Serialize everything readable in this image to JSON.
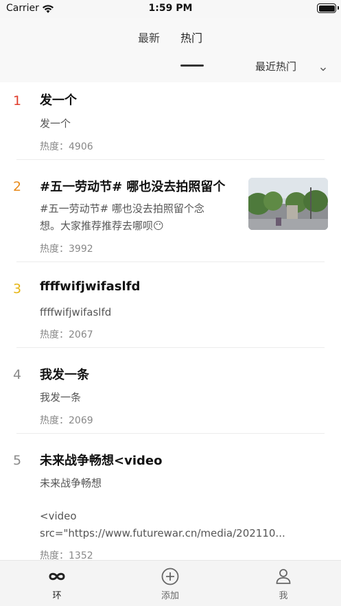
{
  "status_bar": {
    "carrier": "Carrier",
    "time": "1:59 PM"
  },
  "header": {
    "tabs": [
      {
        "label": "最新"
      },
      {
        "label": "热门"
      }
    ],
    "sort_label": "最近热门"
  },
  "feed": {
    "items": [
      {
        "rank": "1",
        "rank_color": "#e03c2b",
        "title": "发一个",
        "excerpt": "发一个",
        "heat": "热度：4906"
      },
      {
        "rank": "2",
        "rank_color": "#e88a1a",
        "title": "#五一劳动节# 哪也没去拍照留个",
        "excerpt_line1": "#五一劳动节# 哪也没去拍照留个念",
        "excerpt_line2": "想。大家推荐推荐去哪呗😶",
        "heat": "热度：3992"
      },
      {
        "rank": "3",
        "rank_color": "#e6b514",
        "title": "ffffwifjwifaslfd",
        "excerpt": "ffffwifjwifaslfd",
        "heat": "热度：2067"
      },
      {
        "rank": "4",
        "rank_color": "#8a8a8a",
        "title": "我发一条",
        "excerpt": "我发一条",
        "heat": "热度：2069"
      },
      {
        "rank": "5",
        "rank_color": "#8a8a8a",
        "title": "未来战争畅想<video",
        "excerpt_line1": "未来战争畅想",
        "excerpt_line2": "<video",
        "excerpt_line3": "src=\"https://www.futurewar.cn/media/202110...",
        "heat": "热度：1352"
      }
    ]
  },
  "tabbar": {
    "items": [
      {
        "label": "环",
        "icon": "infinity-icon"
      },
      {
        "label": "添加",
        "icon": "add-circle-icon"
      },
      {
        "label": "我",
        "icon": "person-icon"
      }
    ]
  },
  "colors": {
    "accent": "#e03c2b",
    "text_secondary": "#888888"
  }
}
